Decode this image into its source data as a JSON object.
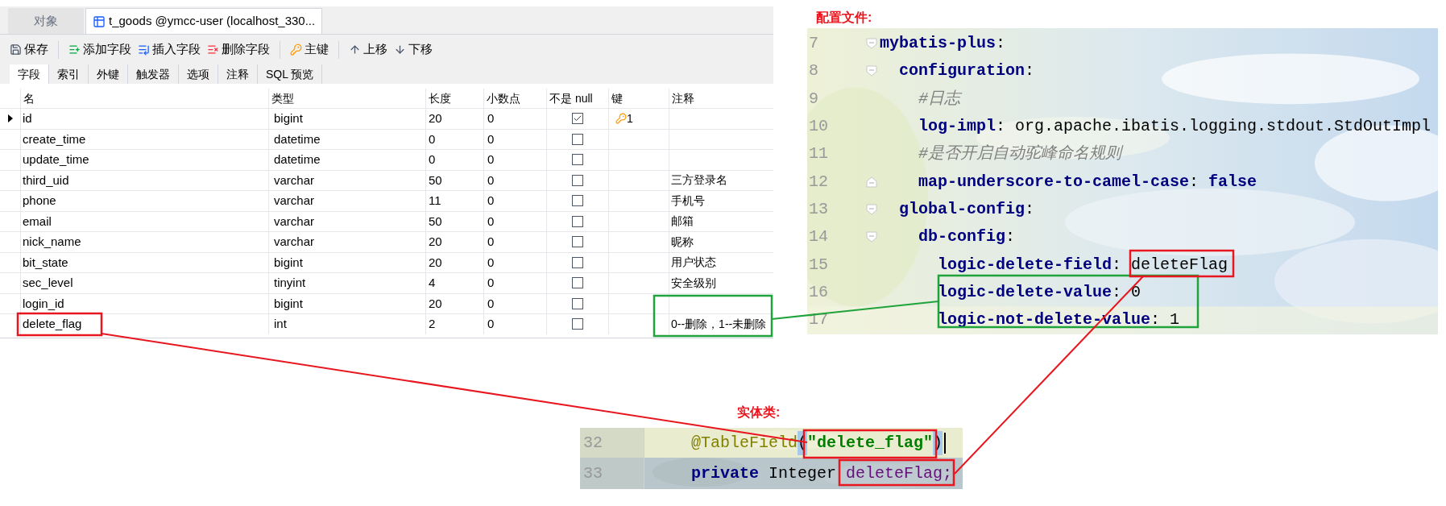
{
  "navicat": {
    "tabs": [
      {
        "label": "对象",
        "selected": false
      },
      {
        "label": "t_goods @ymcc-user (localhost_330...",
        "selected": true
      }
    ],
    "toolbar": [
      {
        "label": "保存",
        "kind": "save"
      },
      {
        "label": "添加字段",
        "kind": "add"
      },
      {
        "label": "插入字段",
        "kind": "insert"
      },
      {
        "label": "删除字段",
        "kind": "delete"
      },
      {
        "label": "主键",
        "kind": "key"
      },
      {
        "label": "上移",
        "kind": "up"
      },
      {
        "label": "下移",
        "kind": "down"
      }
    ],
    "subtabs": [
      {
        "label": "字段",
        "selected": true
      },
      {
        "label": "索引",
        "selected": false
      },
      {
        "label": "外键",
        "selected": false
      },
      {
        "label": "触发器",
        "selected": false
      },
      {
        "label": "选项",
        "selected": false
      },
      {
        "label": "注释",
        "selected": false
      },
      {
        "label": "SQL 预览",
        "selected": false
      }
    ],
    "columns": [
      "名",
      "类型",
      "长度",
      "小数点",
      "不是 null",
      "键",
      "注释"
    ],
    "rows": [
      {
        "name": "id",
        "type": "bigint",
        "length": "20",
        "decimals": "0",
        "not_null": true,
        "key": "1",
        "current": true
      },
      {
        "name": "create_time",
        "type": "datetime",
        "length": "0",
        "decimals": "0",
        "not_null": false,
        "current": false
      },
      {
        "name": "update_time",
        "type": "datetime",
        "length": "0",
        "decimals": "0",
        "not_null": false,
        "current": false
      },
      {
        "name": "third_uid",
        "type": "varchar",
        "length": "50",
        "decimals": "0",
        "not_null": false,
        "comment": "三方登录名",
        "current": false
      },
      {
        "name": "phone",
        "type": "varchar",
        "length": "11",
        "decimals": "0",
        "not_null": false,
        "comment": "手机号",
        "current": false
      },
      {
        "name": "email",
        "type": "varchar",
        "length": "50",
        "decimals": "0",
        "not_null": false,
        "comment": "邮箱",
        "current": false
      },
      {
        "name": "nick_name",
        "type": "varchar",
        "length": "20",
        "decimals": "0",
        "not_null": false,
        "comment": "昵称",
        "current": false
      },
      {
        "name": "bit_state",
        "type": "bigint",
        "length": "20",
        "decimals": "0",
        "not_null": false,
        "comment": "用户状态",
        "current": false
      },
      {
        "name": "sec_level",
        "type": "tinyint",
        "length": "4",
        "decimals": "0",
        "not_null": false,
        "comment": "安全级别",
        "current": false
      },
      {
        "name": "login_id",
        "type": "bigint",
        "length": "20",
        "decimals": "0",
        "not_null": false,
        "current": false
      },
      {
        "name": "delete_flag",
        "type": "int",
        "length": "2",
        "decimals": "0",
        "not_null": false,
        "comment": "0--删除，1--未删除",
        "current": false
      }
    ]
  },
  "config_label": "配置文件:",
  "config_code": [
    {
      "number": "7",
      "fold_open": true,
      "fold_close": false,
      "segments": [
        {
          "text": "mybatis-plus",
          "kind": "key"
        },
        {
          "text": ":",
          "kind": "plain"
        }
      ]
    },
    {
      "number": "8",
      "fold_open": true,
      "fold_close": false,
      "segments": [
        {
          "text": "  configuration",
          "kind": "key"
        },
        {
          "text": ":",
          "kind": "plain"
        }
      ]
    },
    {
      "number": "9",
      "fold_open": false,
      "fold_close": false,
      "segments": [
        {
          "text": "    #日志",
          "kind": "comment"
        }
      ]
    },
    {
      "number": "10",
      "fold_open": false,
      "fold_close": false,
      "segments": [
        {
          "text": "    log-impl",
          "kind": "key"
        },
        {
          "text": ": org.apache.ibatis.logging.stdout.StdOutImpl",
          "kind": "plain"
        }
      ]
    },
    {
      "number": "11",
      "fold_open": false,
      "fold_close": false,
      "segments": [
        {
          "text": "    #是否开启自动驼峰命名规则",
          "kind": "comment"
        }
      ]
    },
    {
      "number": "12",
      "fold_open": false,
      "fold_close": true,
      "segments": [
        {
          "text": "    map-underscore-to-camel-case",
          "kind": "key"
        },
        {
          "text": ": ",
          "kind": "plain"
        },
        {
          "text": "false",
          "kind": "bool"
        }
      ]
    },
    {
      "number": "13",
      "fold_open": true,
      "fold_close": false,
      "segments": [
        {
          "text": "  global-config",
          "kind": "key"
        },
        {
          "text": ":",
          "kind": "plain"
        }
      ]
    },
    {
      "number": "14",
      "fold_open": true,
      "fold_close": false,
      "segments": [
        {
          "text": "    db-config",
          "kind": "key"
        },
        {
          "text": ":",
          "kind": "plain"
        }
      ]
    },
    {
      "number": "15",
      "fold_open": false,
      "fold_close": false,
      "segments": [
        {
          "text": "      logic-delete-field",
          "kind": "key"
        },
        {
          "text": ": deleteFlag",
          "kind": "plain"
        }
      ]
    },
    {
      "number": "16",
      "fold_open": false,
      "fold_close": false,
      "segments": [
        {
          "text": "      logic-delete-value",
          "kind": "key"
        },
        {
          "text": ": 0",
          "kind": "plain"
        }
      ]
    },
    {
      "number": "17",
      "fold_open": false,
      "fold_close": false,
      "segments": [
        {
          "text": "      logic-not-delete-value",
          "kind": "key"
        },
        {
          "text": ": 1",
          "kind": "plain"
        }
      ]
    }
  ],
  "entity_label": "实体类:",
  "entity_code": [
    {
      "number": "32",
      "current": true,
      "segments": [
        {
          "text": "    @TableField",
          "kind": "annotation"
        },
        {
          "text": "(",
          "kind": "brace"
        },
        {
          "text": "\"delete_flag\"",
          "kind": "string"
        },
        {
          "text": ")",
          "kind": "brace"
        }
      ]
    },
    {
      "number": "33",
      "current": false,
      "segments": [
        {
          "text": "    private",
          "kind": "keyword"
        },
        {
          "text": " Integer ",
          "kind": "plain"
        },
        {
          "text": "deleteFlag;",
          "kind": "field"
        }
      ]
    }
  ],
  "annotations": [
    {
      "kind": "box",
      "color": "#e8161e"
    },
    {
      "kind": "line",
      "color": "#e8161e"
    },
    {
      "kind": "box",
      "color": "#1fa33a"
    },
    {
      "kind": "line",
      "color": "#1fa33a"
    },
    {
      "kind": "box",
      "color": "#1fa33a"
    },
    {
      "kind": "box",
      "color": "#e8161e"
    },
    {
      "kind": "line",
      "color": "#e8161e"
    },
    {
      "kind": "box",
      "color": "#e8161e"
    },
    {
      "kind": "box",
      "color": "#e8161e"
    }
  ]
}
